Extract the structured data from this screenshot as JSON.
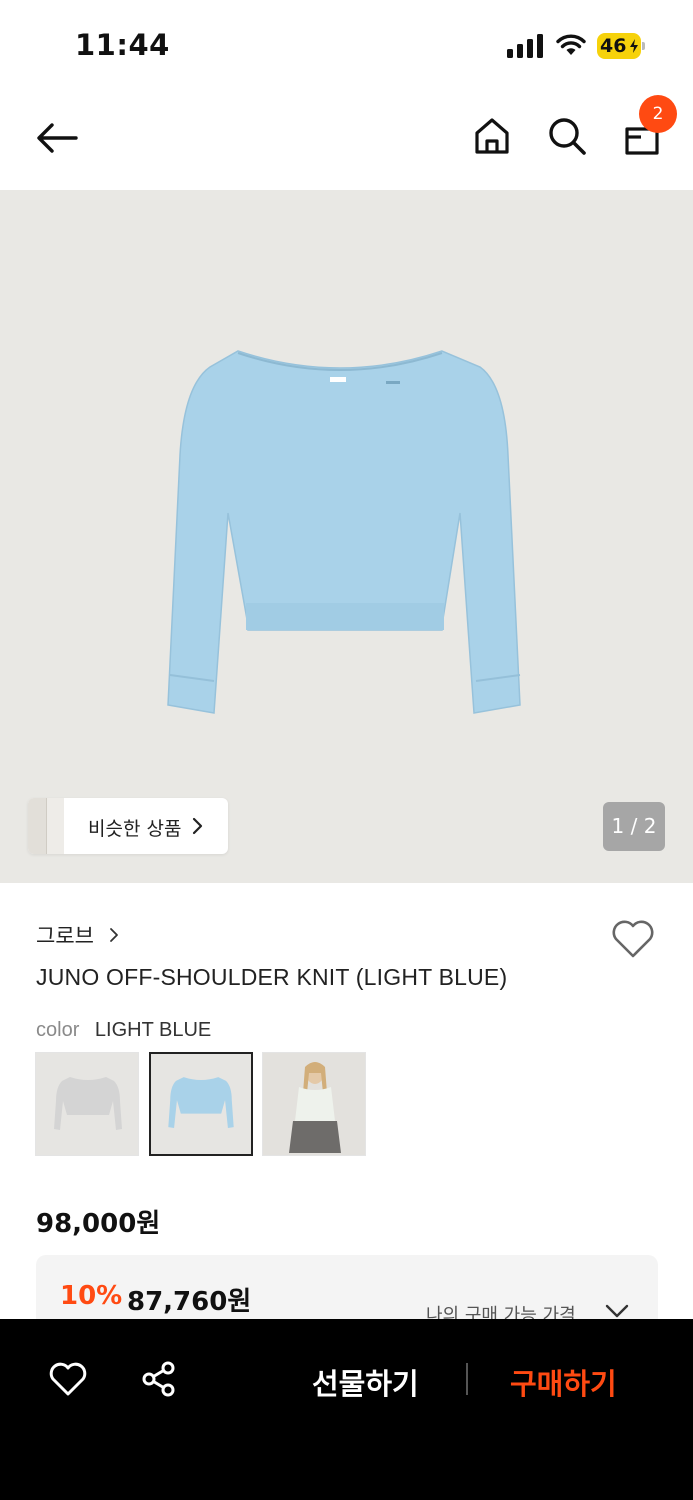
{
  "status_bar": {
    "time": "11:44",
    "battery": "46"
  },
  "nav": {
    "cart_count": "2"
  },
  "hero": {
    "similar_label": "비슷한 상품",
    "page_counter": "1 / 2"
  },
  "product": {
    "brand": "그로브",
    "title": "JUNO OFF-SHOULDER KNIT (LIGHT BLUE)",
    "color_label": "color",
    "color_value": "LIGHT BLUE",
    "price": "98,000원",
    "discount_rate": "10%",
    "discount_price": "87,760원",
    "buyable_price_label": "나의 구매 가능 가격"
  },
  "bottom_bar": {
    "gift_label": "선물하기",
    "buy_label": "구매하기"
  },
  "colors": {
    "accent": "#ff4a12",
    "knit_blue": "#a9d2e9",
    "hero_bg": "#e9e8e4"
  },
  "icons": [
    "back-arrow-icon",
    "home-icon",
    "search-icon",
    "cart-icon",
    "heart-icon",
    "share-icon",
    "chevron-right-icon",
    "chevron-down-icon"
  ]
}
